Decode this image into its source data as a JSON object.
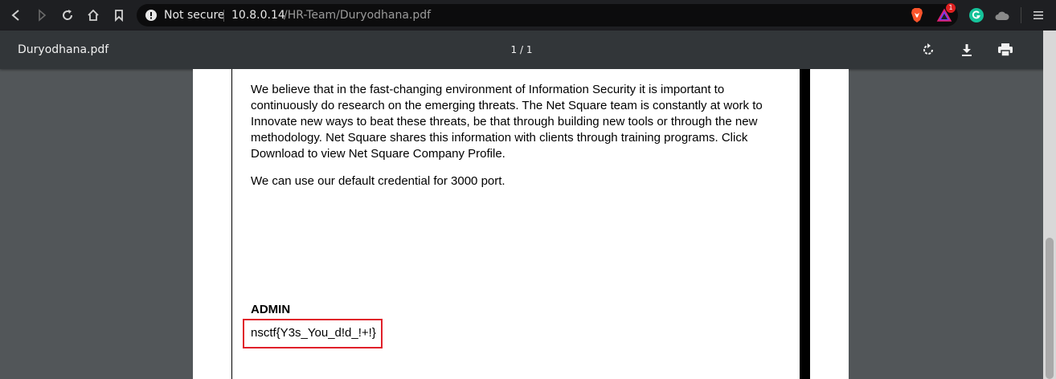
{
  "browser": {
    "security_label": "Not secure",
    "url_host": "10.8.0.14",
    "url_path": "/HR-Team/Duryodhana.pdf",
    "notification_badge": "1"
  },
  "pdf_viewer": {
    "filename": "Duryodhana.pdf",
    "page_indicator": "1 / 1"
  },
  "document": {
    "paragraph1": "We believe that in the fast-changing environment of Information Security it is important to continuously do research on the emerging threats. The Net Square team is constantly at work to Innovate new ways to beat these threats, be that through building new tools or through the new methodology. Net Square shares this information with clients through training programs. Click Download to view Net Square Company Profile.",
    "paragraph2": "We can use our default credential for 3000 port.",
    "admin_heading": "ADMIN",
    "flag": "nsctf{Y3s_You_d!d_!+!}"
  },
  "colors": {
    "highlight_border": "#e0202a",
    "brave_orange": "#fb542b",
    "grammarly_green": "#15c39a"
  }
}
